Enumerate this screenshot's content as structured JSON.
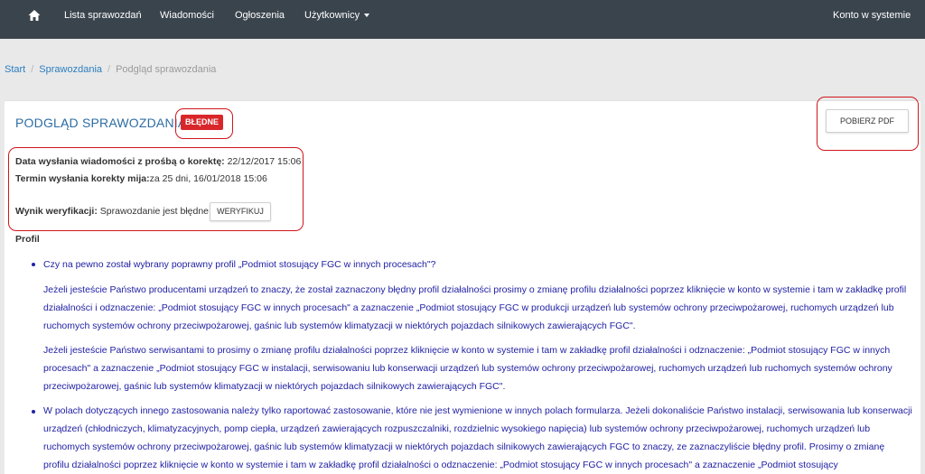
{
  "nav": {
    "home_icon": "home-icon",
    "items": [
      "Lista sprawozdań",
      "Wiadomości",
      "Ogłoszenia",
      "Użytkownicy"
    ],
    "account": "Konto w systemie"
  },
  "breadcrumb": [
    "Start",
    "Sprawozdania",
    "Podgląd sprawozdania"
  ],
  "panel": {
    "title": "PODGLĄD SPRAWOZDANIA",
    "status_badge": "BŁĘDNE",
    "pdf_button": "POBIERZ PDF"
  },
  "meta": {
    "sent_label": "Data wysłania wiadomości z prośbą o korektę:",
    "sent_value": " 22/12/2017 15:06",
    "deadline_label": "Termin wysłania korekty mija:",
    "deadline_value": "za 25 dni, 16/01/2018 15:06",
    "result_label": "Wynik weryfikacji:",
    "result_value": " Sprawozdanie jest błędne.",
    "verify_button": "WERYFIKUJ"
  },
  "profile": {
    "heading": "Profil",
    "q1": "Czy na pewno został wybrany poprawny profil „Podmiot stosujący FGC w innych procesach\"?",
    "p1": "Jeżeli jesteście Państwo producentami urządzeń to znaczy, że został zaznaczony błędny profil działalności prosimy o zmianę profilu działalności poprzez kliknięcie w konto w systemie i tam w zakładkę profil działalności i odznaczenie: „Podmiot stosujący FGC w innych procesach\" a zaznaczenie „Podmiot stosujący FGC w produkcji urządzeń lub systemów ochrony przeciwpożarowej, ruchomych urządzeń lub ruchomych systemów ochrony przeciwpożarowej, gaśnic lub systemów klimatyzacji w niektórych pojazdach silnikowych zawierających FGC\".",
    "p2": "Jeżeli jesteście Państwo serwisantami to prosimy o zmianę profilu działalności poprzez kliknięcie w konto w systemie i tam w zakładkę profil działalności i odznaczenie: „Podmiot stosujący FGC w innych procesach\" a zaznaczenie „Podmiot stosujący FGC w instalacji, serwisowaniu lub konserwacji urządzeń lub systemów ochrony przeciwpożarowej, ruchomych urządzeń lub ruchomych systemów ochrony przeciwpożarowej, gaśnic lub systemów klimatyzacji w niektórych pojazdach silnikowych zawierających FGC\".",
    "q2": "W polach dotyczących innego zastosowania należy tylko raportować zastosowanie, które nie jest wymienione w innych polach formularza. Jeżeli dokonaliście Państwo instalacji, serwisowania lub konserwacji urządzeń (chłodniczych, klimatyzacyjnych, pomp ciepła, urządzeń zawierających rozpuszczalniki, rozdzielnic wysokiego napięcia) lub systemów ochrony przeciwpożarowej, ruchomych urządzeń lub ruchomych systemów ochrony przeciwpożarowej, gaśnic lub systemów klimatyzacji w niektórych pojazdach silnikowych zawierających FGC to znaczy, ze zaznaczyliście błędny profil. Prosimy o zmianę profilu działalności poprzez kliknięcie w konto w systemie i tam w zakładkę profil działalności o odznaczenie: „Podmiot stosujący FGC w innych procesach\" a zaznaczenie „Podmiot stosujący"
  }
}
